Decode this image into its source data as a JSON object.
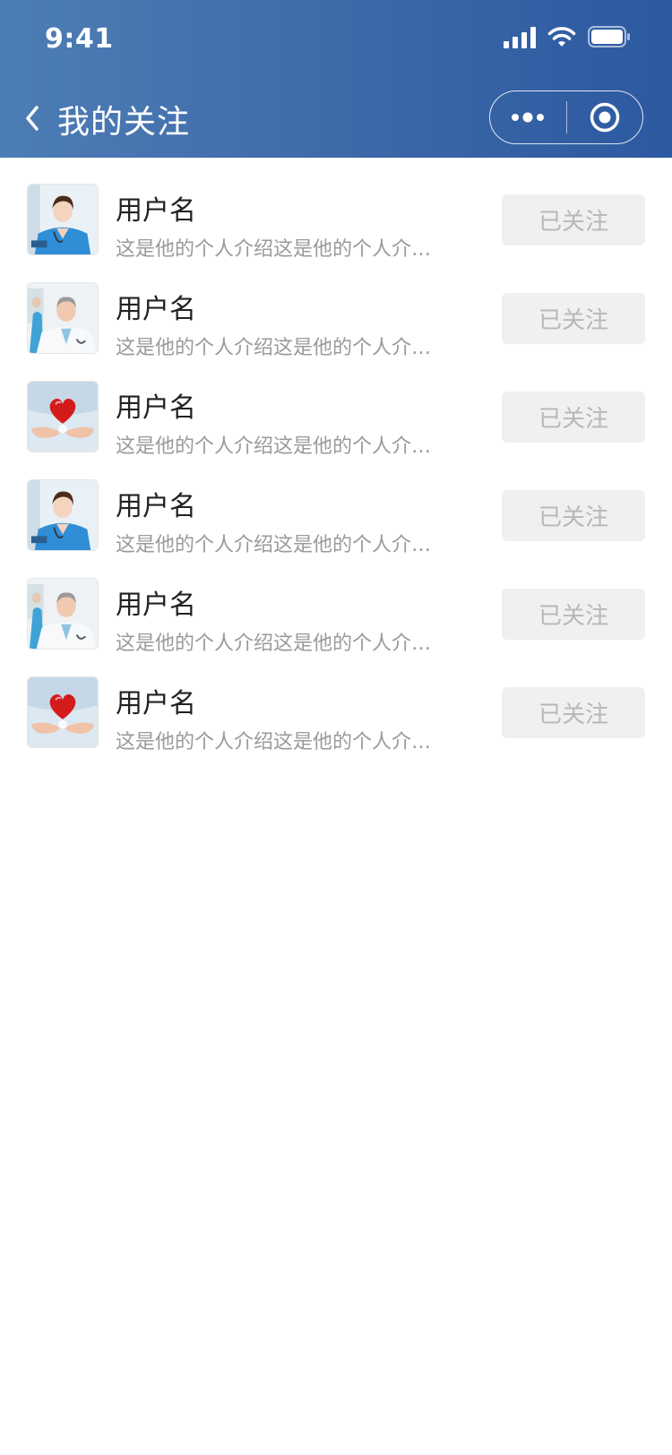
{
  "status_bar": {
    "time": "9:41"
  },
  "nav": {
    "title": "我的关注"
  },
  "users": [
    {
      "name": "用户名",
      "bio": "这是他的个人介绍这是他的个人介绍这是他的个人介绍",
      "button": "已关注",
      "avatar": "nurse-avatar-icon"
    },
    {
      "name": "用户名",
      "bio": "这是他的个人介绍这是他的个人介绍这是他的个人介绍",
      "button": "已关注",
      "avatar": "doctor-avatar-icon"
    },
    {
      "name": "用户名",
      "bio": "这是他的个人介绍这是他的个人介绍这是他的个人介绍",
      "button": "已关注",
      "avatar": "heart-hands-avatar-icon"
    },
    {
      "name": "用户名",
      "bio": "这是他的个人介绍这是他的个人介绍这是他的个人介绍",
      "button": "已关注",
      "avatar": "nurse-avatar-icon"
    },
    {
      "name": "用户名",
      "bio": "这是他的个人介绍这是他的个人介绍这是他的个人介绍",
      "button": "已关注",
      "avatar": "doctor-avatar-icon"
    },
    {
      "name": "用户名",
      "bio": "这是他的个人介绍这是他的个人介绍这是他的个人介绍",
      "button": "已关注",
      "avatar": "heart-hands-avatar-icon"
    }
  ]
}
